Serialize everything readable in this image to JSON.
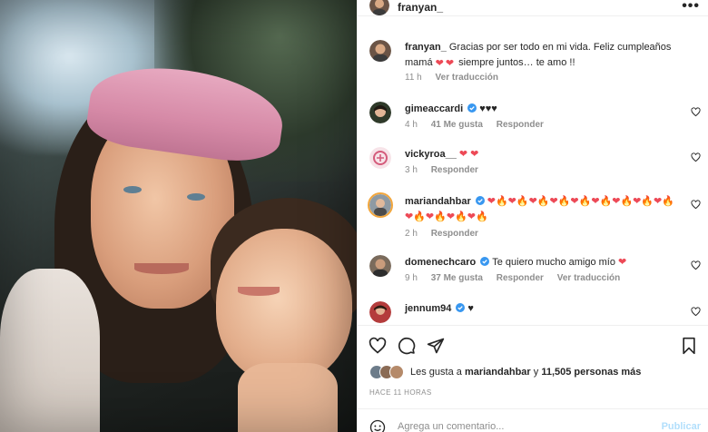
{
  "post": {
    "username": "franyan_",
    "more_label": "•••"
  },
  "comments": [
    {
      "username": "franyan_",
      "text_parts": [
        "Gracias por ser todo en mi vida. Feliz cumpleaños mamá ",
        "❤",
        "❤",
        " siempre juntos… te amo !!"
      ],
      "verified": false,
      "time": "11 h",
      "likes": "",
      "reply": "",
      "translate": "Ver traducción"
    },
    {
      "username": "gimeaccardi",
      "verified": true,
      "text": "♥♥♥",
      "time": "4 h",
      "likes": "41 Me gusta",
      "reply": "Responder"
    },
    {
      "username": "vickyroa__",
      "verified": false,
      "hearts": "❤ ❤",
      "time": "3 h",
      "reply": "Responder"
    },
    {
      "username": "mariandahbar",
      "verified": true,
      "emoji_sequence": "❤🔥❤🔥❤🔥❤🔥❤🔥❤🔥❤🔥❤🔥❤🔥❤🔥❤🔥❤🔥❤🔥",
      "time": "2 h",
      "reply": "Responder"
    },
    {
      "username": "domenechcaro",
      "verified": true,
      "text": "Te quiero mucho amigo mío ",
      "heart": "❤",
      "time": "9 h",
      "likes": "37 Me gusta",
      "reply": "Responder",
      "translate": "Ver traducción"
    },
    {
      "username": "jennum94",
      "verified": true,
      "text": "♥"
    }
  ],
  "likes_summary": {
    "prefix": "Les gusta a ",
    "user": "mariandahbar",
    "middle": " y ",
    "count": "11,505 personas más"
  },
  "timestamp": "HACE 11 HORAS",
  "composer": {
    "placeholder": "Agrega un comentario...",
    "post_label": "Publicar"
  },
  "colors": {
    "heart_red": "#ed4956",
    "verified_blue": "#3897f0",
    "link_disabled": "#b2dffc",
    "muted_text": "#8e8e8e"
  }
}
